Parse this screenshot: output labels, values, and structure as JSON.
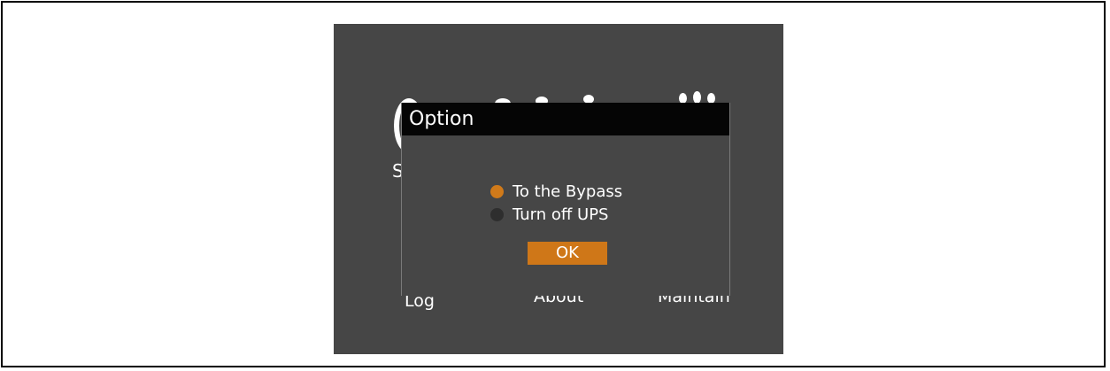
{
  "dialog": {
    "title": "Option",
    "options": [
      {
        "label": "To the Bypass",
        "selected": true
      },
      {
        "label": "Turn off UPS",
        "selected": false
      }
    ],
    "ok_label": "OK"
  },
  "background": {
    "partial_letter": "S"
  },
  "nav": {
    "log": "Log",
    "about": "About",
    "maintain": "Maintain"
  },
  "colors": {
    "screen_bg": "#464646",
    "title_bar": "#050505",
    "accent": "#cf7718",
    "radio_off": "#2e2e2e"
  }
}
